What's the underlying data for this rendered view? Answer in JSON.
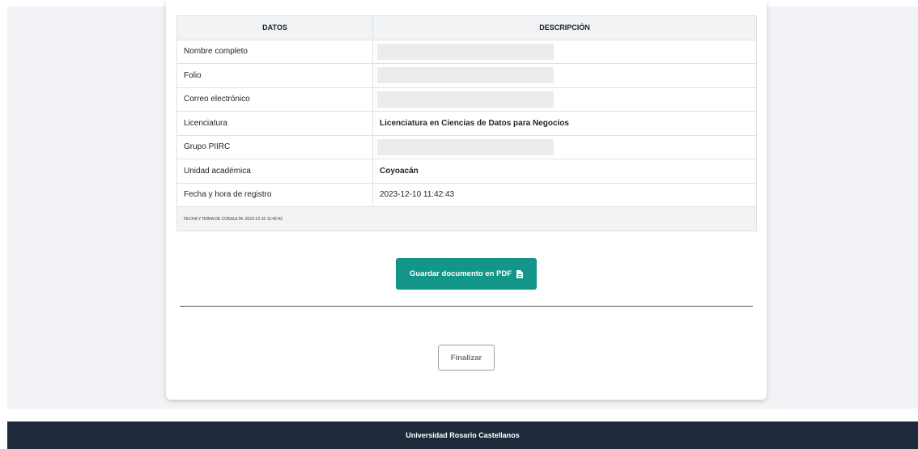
{
  "table": {
    "headers": {
      "data": "DATOS",
      "description": "DESCRIPCIÓN"
    },
    "rows": [
      {
        "label": "Nombre completo",
        "value": ""
      },
      {
        "label": "Folio",
        "value": ""
      },
      {
        "label": "Correo electrónico",
        "value": ""
      },
      {
        "label": "Licenciatura",
        "value": "Licenciatura en Ciencias de Datos para Negocios"
      },
      {
        "label": "Grupo PIIRC",
        "value": ""
      },
      {
        "label": "Unidad académica",
        "value": "Coyoacán"
      },
      {
        "label": "Fecha y hora de registro",
        "value": "2023-12-10 11:42:43"
      }
    ],
    "consult_timestamp": "FECHA Y HORA DE CONSULTA: 2023-12-10 11:42:43"
  },
  "actions": {
    "save_pdf_label": "Guardar documento en PDF",
    "finish_label": "Finalizar"
  },
  "footer": {
    "text": "Universidad Rosario Castellanos"
  },
  "colors": {
    "primary_button": "#13958a",
    "footer_bg": "#1e2a3b",
    "page_bg": "#f1f3f6"
  }
}
